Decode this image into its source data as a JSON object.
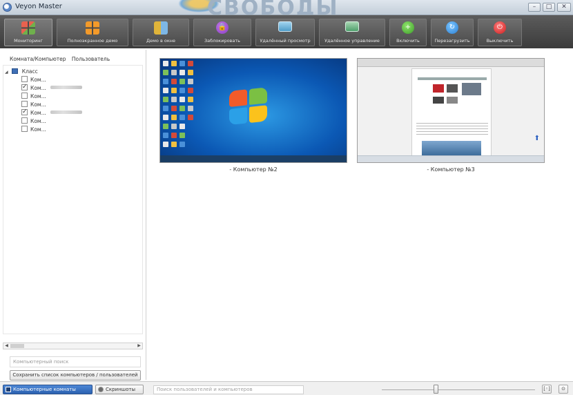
{
  "window": {
    "title": "Veyon Master",
    "banner_text": "СВОБОДЫ",
    "controls": {
      "minimize": "–",
      "maximize": "□",
      "close": "✕"
    }
  },
  "toolbar": {
    "buttons": [
      {
        "label": "Мониторинг",
        "icon": "monitoring-icon",
        "active": true
      },
      {
        "label": "Полноэкранное демо",
        "icon": "fullscreen-demo-icon",
        "active": false
      },
      {
        "label": "Демо в окне",
        "icon": "window-demo-icon",
        "active": false
      },
      {
        "label": "Заблокировать",
        "icon": "lock-icon",
        "active": false
      },
      {
        "label": "Удалённый просмотр",
        "icon": "remote-view-icon",
        "active": false
      },
      {
        "label": "Удалённое управление",
        "icon": "remote-control-icon",
        "active": false
      },
      {
        "label": "Включить",
        "icon": "power-on-icon",
        "active": false
      },
      {
        "label": "Перезагрузить",
        "icon": "reboot-icon",
        "active": false
      },
      {
        "label": "Выключить",
        "icon": "power-off-icon",
        "active": false
      }
    ]
  },
  "left_panel": {
    "columns": [
      "Комната/Компьютер",
      "Пользователь"
    ],
    "group": {
      "label": "Класс",
      "expanded": true
    },
    "computers": [
      {
        "label": "Ком...",
        "checked": false,
        "has_user": false
      },
      {
        "label": "Ком...",
        "checked": true,
        "has_user": true
      },
      {
        "label": "Ком...",
        "checked": false,
        "has_user": false
      },
      {
        "label": "Ком...",
        "checked": false,
        "has_user": false
      },
      {
        "label": "Ком...",
        "checked": true,
        "has_user": true
      },
      {
        "label": "Ком...",
        "checked": false,
        "has_user": false
      },
      {
        "label": "Ком...",
        "checked": false,
        "has_user": false
      }
    ],
    "search_placeholder": "Компьютерный поиск",
    "save_button": "Сохранить список компьютеров / пользователей"
  },
  "main": {
    "screens": [
      {
        "caption": "- Компьютер №2",
        "kind": "windows7-desktop"
      },
      {
        "caption": "- Компьютер №3",
        "kind": "browser-window"
      }
    ]
  },
  "statusbar": {
    "tabs": [
      {
        "label": "Компьютерные комнаты",
        "active": true
      },
      {
        "label": "Скриншоты",
        "active": false
      }
    ],
    "search_placeholder": "Поиск пользователей и компьютеров",
    "zoom_fraction": 0.35,
    "buttons": [
      "[◦]",
      "⊙"
    ]
  },
  "colors": {
    "toolbar_bg": "#4a4a4a",
    "active_tab": "#2b61b0",
    "desktop_blue": "#0b58b4"
  }
}
